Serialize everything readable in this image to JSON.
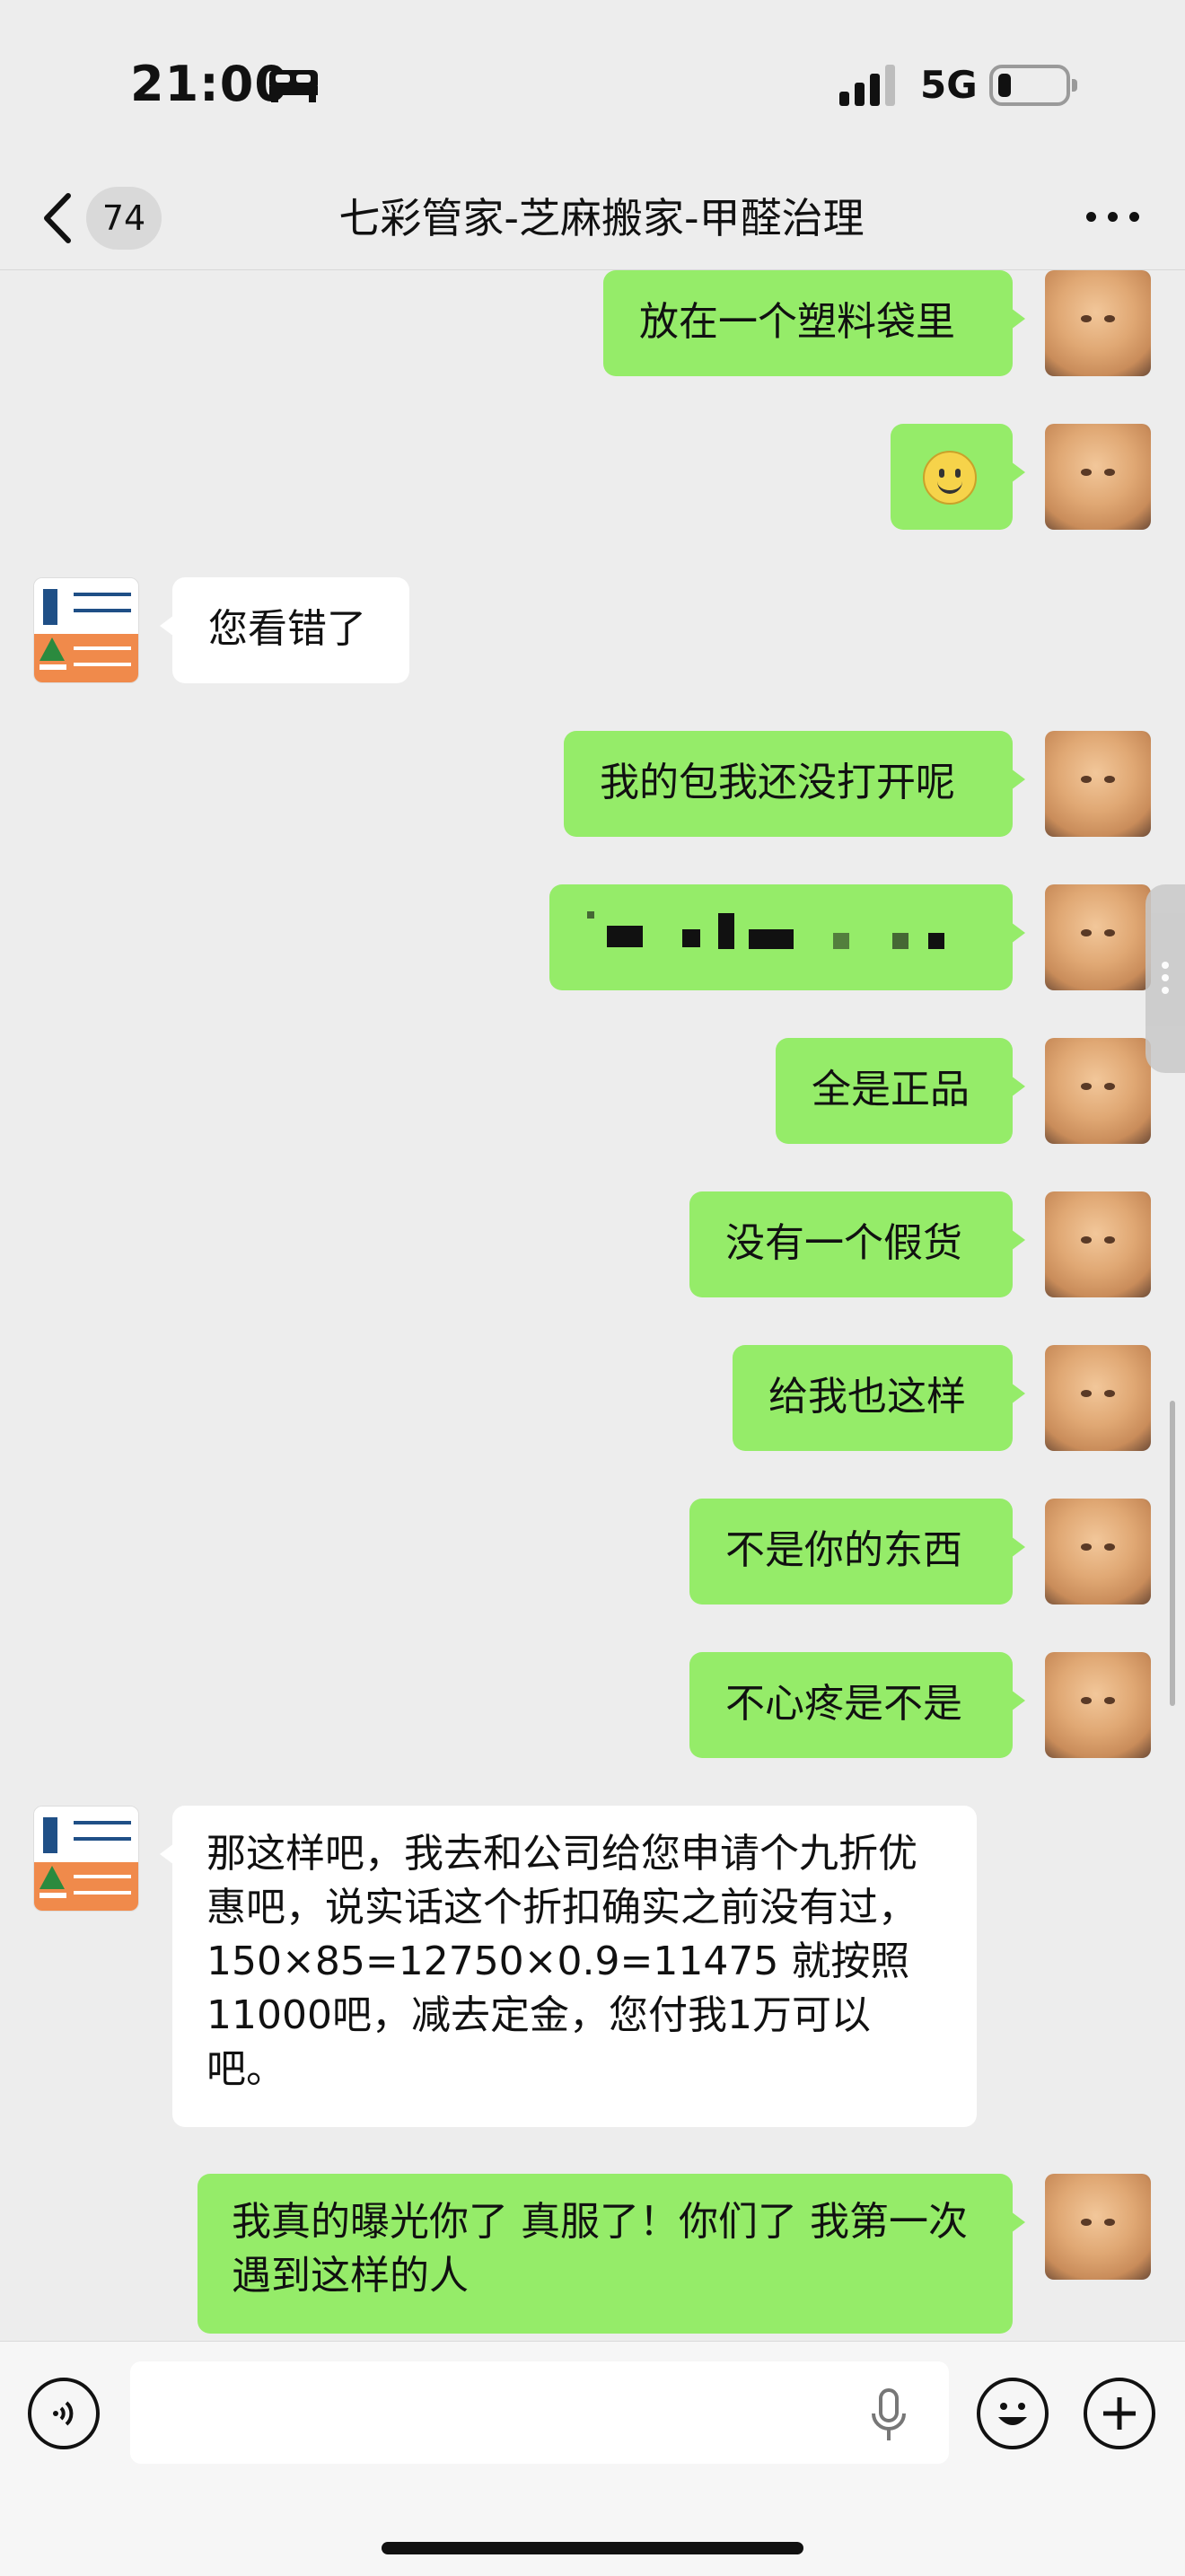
{
  "status_bar": {
    "time": "21:00",
    "network": "5G",
    "icons": [
      "bed-icon",
      "signal-icon",
      "battery-icon"
    ]
  },
  "nav": {
    "unread_count": "74",
    "title": "七彩管家-芝麻搬家-甲醛治理",
    "icons": [
      "back-chevron-icon",
      "more-dots-icon"
    ]
  },
  "messages": [
    {
      "side": "out",
      "text": "放在一个塑料袋里"
    },
    {
      "side": "out",
      "type": "emoji",
      "icon": "smile-emoji-icon"
    },
    {
      "side": "in",
      "text": "您看错了"
    },
    {
      "side": "out",
      "text": "我的包我还没打开呢"
    },
    {
      "side": "out",
      "type": "redacted"
    },
    {
      "side": "out",
      "text": "全是正品"
    },
    {
      "side": "out",
      "text": "没有一个假货"
    },
    {
      "side": "out",
      "text": "给我也这样"
    },
    {
      "side": "out",
      "text": "不是你的东西"
    },
    {
      "side": "out",
      "text": "不心疼是不是"
    },
    {
      "side": "in",
      "text": "那这样吧，我去和公司给您申请个九折优惠吧，说实话这个折扣确实之前没有过，150×85=12750×0.9=11475 就按照11000吧，减去定金，您付我1万可以吧。"
    },
    {
      "side": "out",
      "text": "我真的曝光你了 真服了！你们了 我第一次遇到这样的人"
    }
  ],
  "input_bar": {
    "icons": [
      "voice-toggle-icon",
      "microphone-icon",
      "emoji-icon",
      "add-icon"
    ]
  },
  "colors": {
    "outgoing_bubble": "#95ec69",
    "incoming_bubble": "#ffffff",
    "background": "#ededed"
  }
}
